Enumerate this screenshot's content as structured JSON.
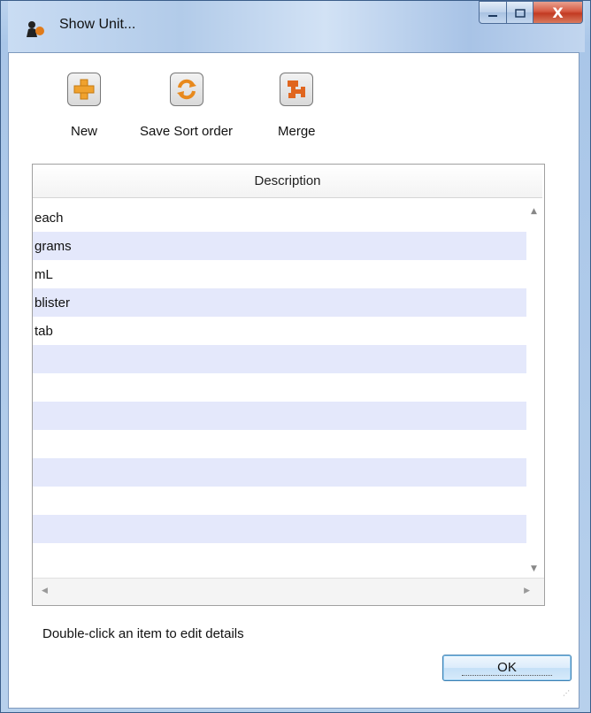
{
  "window": {
    "title": "Show Unit...",
    "close_glyph": "X",
    "accent": "#c23a22"
  },
  "toolbar": {
    "new_label": "New",
    "save_sort_label": "Save Sort order",
    "merge_label": "Merge"
  },
  "list": {
    "column_header": "Description",
    "rows": [
      "each",
      "grams",
      "mL",
      "blister",
      "tab",
      "",
      "",
      "",
      "",
      "",
      "",
      "",
      ""
    ],
    "row_alt_color": "#e4e8fb"
  },
  "hint": "Double-click an item to edit details",
  "ok_label": "OK",
  "icons": {
    "app": "user-icon",
    "new": "plus-icon",
    "save_sort": "refresh-icon",
    "merge": "merge-icon"
  }
}
